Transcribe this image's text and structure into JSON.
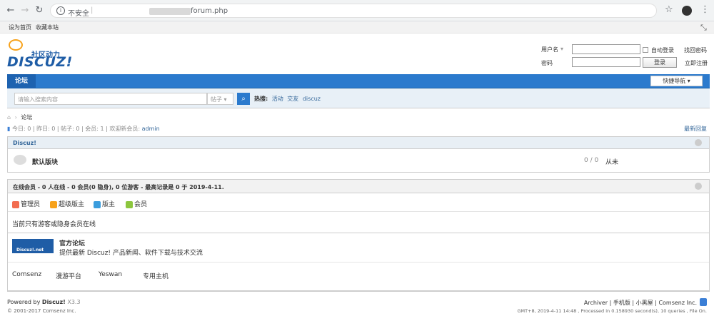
{
  "browser": {
    "insecure_label": "不安全",
    "url_tail": "forum.php"
  },
  "topbar": {
    "set_home": "设为首页",
    "bookmark": "收藏本站"
  },
  "logo": {
    "tagline": "社区动力",
    "wordmark": "DISCUZ!"
  },
  "login": {
    "username_label": "用户名",
    "password_label": "密码",
    "auto_login": "自动登录",
    "find_password": "找回密码",
    "login_button": "登录",
    "register": "立即注册"
  },
  "nav": {
    "forum_tab": "论坛",
    "quick_nav": "快捷导航"
  },
  "search": {
    "placeholder": "请输入搜索内容",
    "type": "帖子",
    "hot_label": "热搜:",
    "hot_items": [
      "活动",
      "交友",
      "discuz"
    ]
  },
  "breadcrumb": {
    "current": "论坛"
  },
  "stats": {
    "today": "今日: 0",
    "yesterday": "昨日: 0",
    "posts": "帖子: 0",
    "members": "会员: 1",
    "welcome": "欢迎新会员:",
    "new_member": "admin",
    "latest_replies": "最新回复"
  },
  "category": {
    "name": "Discuz!",
    "forum_name": "默认版块",
    "counts": "0 / 0",
    "last_post": "从未"
  },
  "online": {
    "heading": "在线会员 - 0 人在线 - 0 会员(0 隐身), 0 位游客 - 最高记录是 0 于 2019-4-11.",
    "legend": [
      {
        "label": "管理员",
        "color": "#f26c4f"
      },
      {
        "label": "超级版主",
        "color": "#f7a21b"
      },
      {
        "label": "版主",
        "color": "#3b9ddd"
      },
      {
        "label": "会员",
        "color": "#8cc63e"
      }
    ],
    "note": "当前只有游客或隐身会员在线"
  },
  "links": {
    "official_title": "官方论坛",
    "official_desc": "提供最新 Discuz! 产品新闻、软件下载与技术交流",
    "logo_text": "Discuz!.net",
    "friends": [
      "Comsenz",
      "漫游平台",
      "Yeswan",
      "专用主机"
    ]
  },
  "footer": {
    "powered_prefix": "Powered by",
    "powered_name": "Discuz!",
    "version": "X3.3",
    "copyright": "© 2001-2017 Comsenz Inc.",
    "right_links": "Archiver | 手机版 | 小黑屋 | Comsenz Inc.",
    "gmt": "GMT+8, 2019-4-11 14:48 , Processed in 0.158930 second(s), 10 queries , File On."
  }
}
